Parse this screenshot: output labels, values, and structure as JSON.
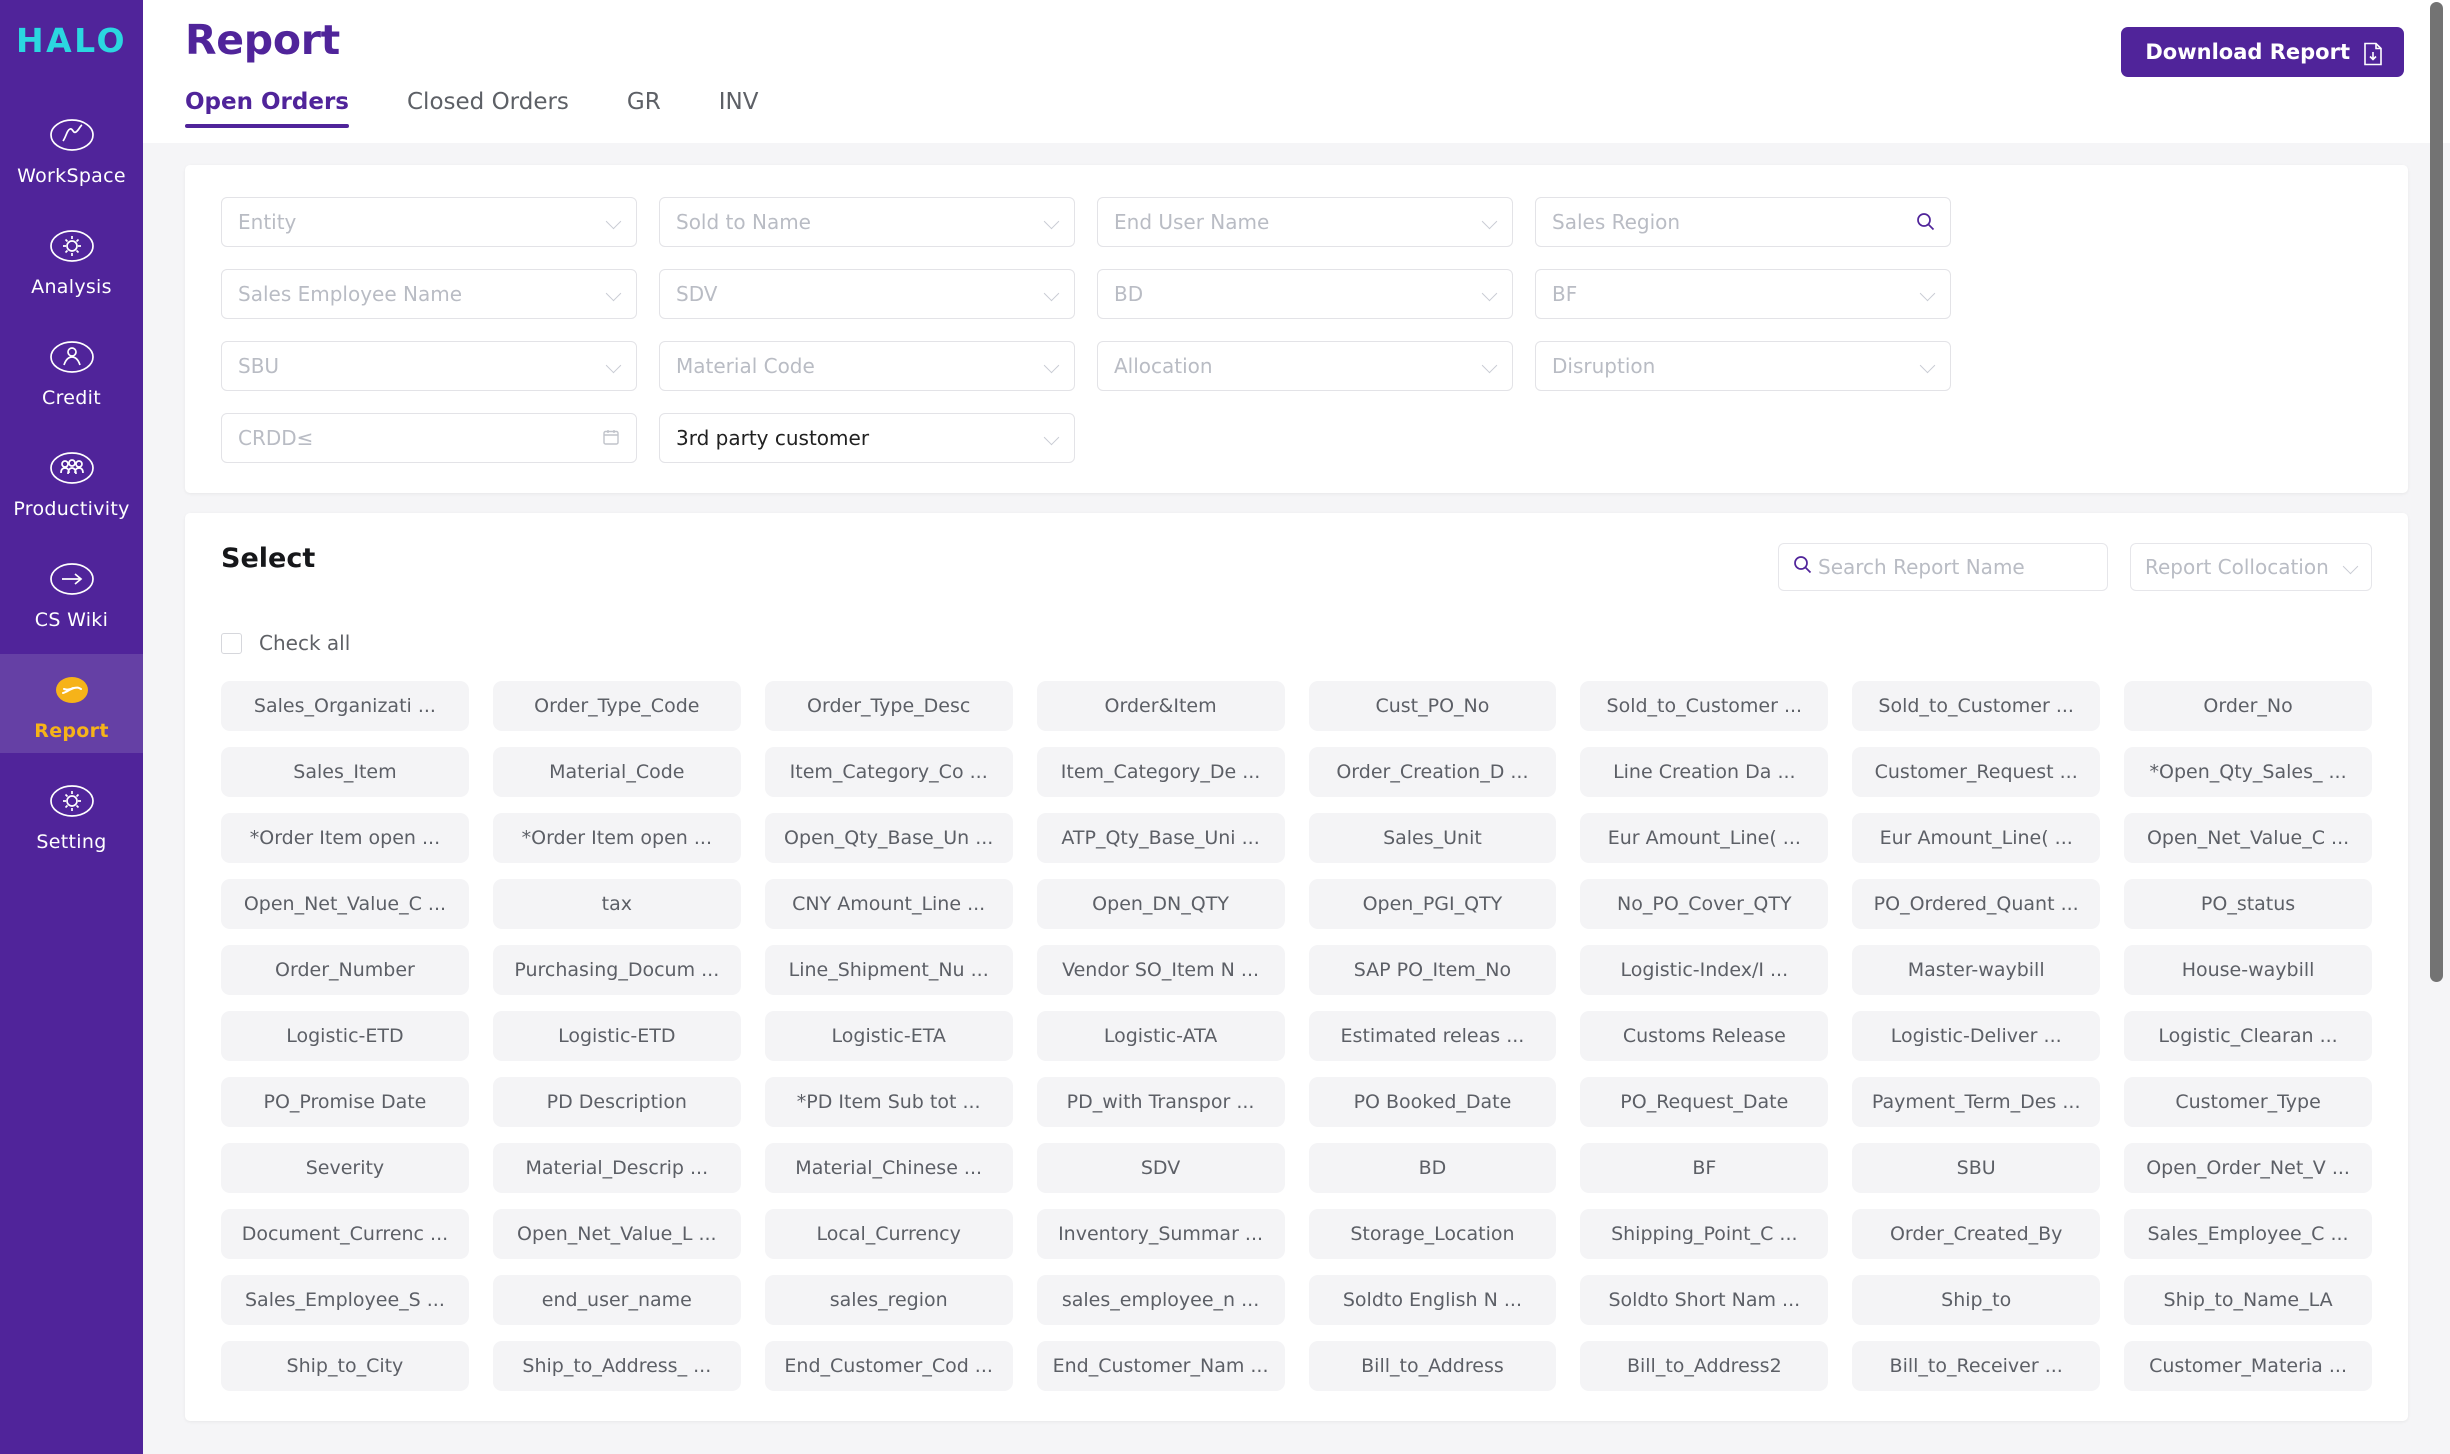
{
  "brand": {
    "logo_text": "HALO",
    "logo_color": "#2bd7e0",
    "sidebar_color": "#50249a",
    "accent_color": "#50249a",
    "active_nav_color": "#f6b319"
  },
  "sidebar": {
    "items": [
      {
        "label": "WorkSpace",
        "icon": "workspace-icon",
        "active": false
      },
      {
        "label": "Analysis",
        "icon": "gear-icon",
        "active": false
      },
      {
        "label": "Credit",
        "icon": "person-badge-icon",
        "active": false
      },
      {
        "label": "Productivity",
        "icon": "people-group-icon",
        "active": false
      },
      {
        "label": "CS Wiki",
        "icon": "arrow-right-circle-icon",
        "active": false
      },
      {
        "label": "Report",
        "icon": "report-hand-icon",
        "active": true
      },
      {
        "label": "Setting",
        "icon": "gear-icon",
        "active": false
      }
    ]
  },
  "header": {
    "title": "Report",
    "download_label": "Download Report",
    "download_icon": "file-download-icon",
    "tabs": [
      {
        "label": "Open Orders",
        "active": true
      },
      {
        "label": "Closed Orders",
        "active": false
      },
      {
        "label": "GR",
        "active": false
      },
      {
        "label": "INV",
        "active": false
      }
    ]
  },
  "filters": [
    {
      "placeholder": "Entity",
      "value": "",
      "control": "select",
      "icon": "chevron-down-icon"
    },
    {
      "placeholder": "Sold to Name",
      "value": "",
      "control": "select",
      "icon": "chevron-down-icon"
    },
    {
      "placeholder": "End User Name",
      "value": "",
      "control": "select",
      "icon": "chevron-down-icon"
    },
    {
      "placeholder": "Sales Region",
      "value": "",
      "control": "search",
      "icon": "search-icon"
    },
    {
      "placeholder": "Sales Employee Name",
      "value": "",
      "control": "select",
      "icon": "chevron-down-icon"
    },
    {
      "placeholder": "SDV",
      "value": "",
      "control": "select",
      "icon": "chevron-down-icon"
    },
    {
      "placeholder": "BD",
      "value": "",
      "control": "select",
      "icon": "chevron-down-icon"
    },
    {
      "placeholder": "BF",
      "value": "",
      "control": "select",
      "icon": "chevron-down-icon"
    },
    {
      "placeholder": "SBU",
      "value": "",
      "control": "select",
      "icon": "chevron-down-icon"
    },
    {
      "placeholder": "Material Code",
      "value": "",
      "control": "select",
      "icon": "chevron-down-icon"
    },
    {
      "placeholder": "Allocation",
      "value": "",
      "control": "select",
      "icon": "chevron-down-icon"
    },
    {
      "placeholder": "Disruption",
      "value": "",
      "control": "select",
      "icon": "chevron-down-icon"
    },
    {
      "placeholder": "CRDD≤",
      "value": "",
      "control": "date",
      "icon": "calendar-icon"
    },
    {
      "placeholder": "3rd party customer",
      "value": "3rd party customer",
      "control": "select",
      "icon": "chevron-down-icon"
    }
  ],
  "select_section": {
    "title": "Select",
    "search_placeholder": "Search Report Name",
    "search_value": "",
    "search_icon": "search-icon",
    "collocation_placeholder": "Report Collocation",
    "collocation_icon": "chevron-down-icon",
    "check_all_label": "Check all",
    "check_all_checked": false,
    "chips": [
      "Sales_Organizati ...",
      "Order_Type_Code",
      "Order_Type_Desc",
      "Order&Item",
      "Cust_PO_No",
      "Sold_to_Customer ...",
      "Sold_to_Customer ...",
      "Order_No",
      "Sales_Item",
      "Material_Code",
      "Item_Category_Co ...",
      "Item_Category_De ...",
      "Order_Creation_D ...",
      "Line Creation Da ...",
      "Customer_Request ...",
      "*Open_Qty_Sales_ ...",
      "*Order Item open ...",
      "*Order Item open ...",
      "Open_Qty_Base_Un ...",
      "ATP_Qty_Base_Uni ...",
      "Sales_Unit",
      "Eur Amount_Line( ...",
      "Eur Amount_Line( ...",
      "Open_Net_Value_C ...",
      "Open_Net_Value_C ...",
      "tax",
      "CNY Amount_Line ...",
      "Open_DN_QTY",
      "Open_PGI_QTY",
      "No_PO_Cover_QTY",
      "PO_Ordered_Quant ...",
      "PO_status",
      "Order_Number",
      "Purchasing_Docum ...",
      "Line_Shipment_Nu ...",
      "Vendor SO_Item N ...",
      "SAP PO_Item_No",
      "Logistic-Index/I ...",
      "Master-waybill",
      "House-waybill",
      "Logistic-ETD",
      "Logistic-ETD",
      "Logistic-ETA",
      "Logistic-ATA",
      "Estimated releas ...",
      "Customs Release",
      "Logistic-Deliver ...",
      "Logistic_Clearan ...",
      "PO_Promise Date",
      "PD Description",
      "*PD Item Sub tot ...",
      "PD_with Transpor ...",
      "PO Booked_Date",
      "PO_Request_Date",
      "Payment_Term_Des ...",
      "Customer_Type",
      "Severity",
      "Material_Descrip ...",
      "Material_Chinese ...",
      "SDV",
      "BD",
      "BF",
      "SBU",
      "Open_Order_Net_V ...",
      "Document_Currenc ...",
      "Open_Net_Value_L ...",
      "Local_Currency",
      "Inventory_Summar ...",
      "Storage_Location",
      "Shipping_Point_C ...",
      "Order_Created_By",
      "Sales_Employee_C ...",
      "Sales_Employee_S ...",
      "end_user_name",
      "sales_region",
      "sales_employee_n ...",
      "Soldto English N ...",
      "Soldto Short Nam ...",
      "Ship_to",
      "Ship_to_Name_LA",
      "Ship_to_City",
      "Ship_to_Address_ ...",
      "End_Customer_Cod ...",
      "End_Customer_Nam ...",
      "Bill_to_Address",
      "Bill_to_Address2",
      "Bill_to_Receiver ...",
      "Customer_Materia ..."
    ]
  }
}
